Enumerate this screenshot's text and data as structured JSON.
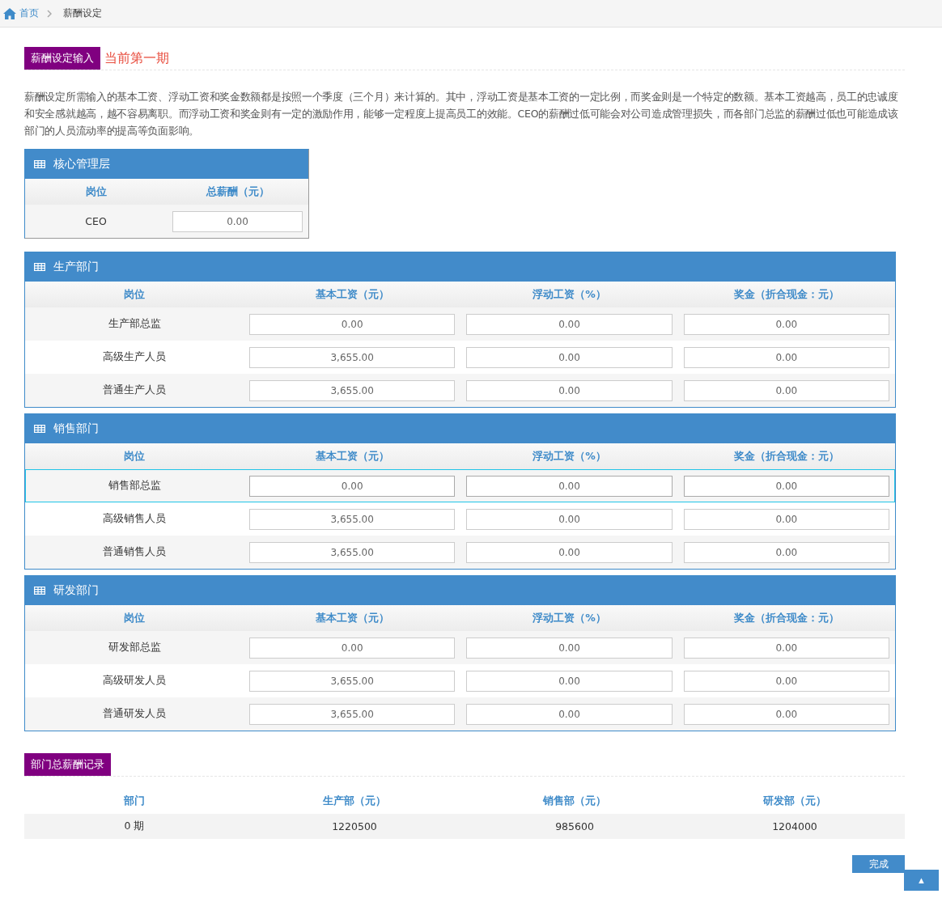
{
  "breadcrumb": {
    "home": "首页",
    "current": "薪酬设定"
  },
  "heading": {
    "badge": "薪酬设定输入",
    "period": "当前第一期"
  },
  "description": "薪酬设定所需输入的基本工资、浮动工资和奖金数额都是按照一个季度（三个月）来计算的。其中，浮动工资是基本工资的一定比例，而奖金则是一个特定的数额。基本工资越高，员工的忠诚度和安全感就越高，越不容易离职。而浮动工资和奖金则有一定的激励作用，能够一定程度上提高员工的效能。CEO的薪酬过低可能会对公司造成管理损失，而各部门总监的薪酬过低也可能造成该部门的人员流动率的提高等负面影响。",
  "core_panel": {
    "title": "核心管理层",
    "columns": [
      "岗位",
      "总薪酬（元）"
    ],
    "rows": [
      {
        "position": "CEO",
        "values": [
          "0.00"
        ],
        "highlighted": false
      }
    ]
  },
  "departments": [
    {
      "title": "生产部门",
      "columns": [
        "岗位",
        "基本工资（元）",
        "浮动工资（%）",
        "奖金（折合现金：元）"
      ],
      "rows": [
        {
          "position": "生产部总监",
          "values": [
            "0.00",
            "0.00",
            "0.00"
          ],
          "highlighted": false
        },
        {
          "position": "高级生产人员",
          "values": [
            "3,655.00",
            "0.00",
            "0.00"
          ],
          "highlighted": false
        },
        {
          "position": "普通生产人员",
          "values": [
            "3,655.00",
            "0.00",
            "0.00"
          ],
          "highlighted": false
        }
      ]
    },
    {
      "title": "销售部门",
      "columns": [
        "岗位",
        "基本工资（元）",
        "浮动工资（%）",
        "奖金（折合现金：元）"
      ],
      "rows": [
        {
          "position": "销售部总监",
          "values": [
            "0.00",
            "0.00",
            "0.00"
          ],
          "highlighted": true
        },
        {
          "position": "高级销售人员",
          "values": [
            "3,655.00",
            "0.00",
            "0.00"
          ],
          "highlighted": false
        },
        {
          "position": "普通销售人员",
          "values": [
            "3,655.00",
            "0.00",
            "0.00"
          ],
          "highlighted": false
        }
      ]
    },
    {
      "title": "研发部门",
      "columns": [
        "岗位",
        "基本工资（元）",
        "浮动工资（%）",
        "奖金（折合现金：元）"
      ],
      "rows": [
        {
          "position": "研发部总监",
          "values": [
            "0.00",
            "0.00",
            "0.00"
          ],
          "highlighted": false
        },
        {
          "position": "高级研发人员",
          "values": [
            "3,655.00",
            "0.00",
            "0.00"
          ],
          "highlighted": false
        },
        {
          "position": "普通研发人员",
          "values": [
            "3,655.00",
            "0.00",
            "0.00"
          ],
          "highlighted": false
        }
      ]
    }
  ],
  "record": {
    "badge": "部门总薪酬记录",
    "columns": [
      "部门",
      "生产部（元）",
      "销售部（元）",
      "研发部（元）"
    ],
    "rows": [
      [
        "0 期",
        "1220500",
        "985600",
        "1204000"
      ]
    ]
  },
  "done_button": "完成",
  "top_button": "▲"
}
